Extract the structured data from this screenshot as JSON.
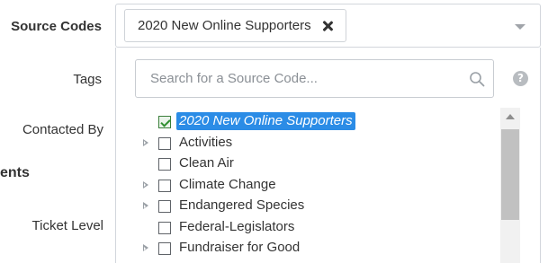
{
  "form": {
    "source_codes_label": "Source Codes",
    "tags_label": "Tags",
    "contacted_by_label": "Contacted By",
    "section_partial_label": "ents",
    "ticket_level_label": "Ticket Level"
  },
  "source_select": {
    "selected_chip": "2020 New Online Supporters",
    "remove_icon": "close-icon",
    "caret_icon": "chevron-down-icon"
  },
  "dropdown": {
    "search_placeholder": "Search for a Source Code...",
    "search_value": "",
    "search_icon": "search-icon",
    "help_icon": "question-circle-icon",
    "help_glyph": "?",
    "items": [
      {
        "label": "2020 New Online Supporters",
        "checked": true,
        "selected": true,
        "expandable": false
      },
      {
        "label": "Activities",
        "checked": false,
        "selected": false,
        "expandable": true
      },
      {
        "label": "Clean Air",
        "checked": false,
        "selected": false,
        "expandable": false
      },
      {
        "label": "Climate Change",
        "checked": false,
        "selected": false,
        "expandable": true
      },
      {
        "label": "Endangered Species",
        "checked": false,
        "selected": false,
        "expandable": true
      },
      {
        "label": "Federal-Legislators",
        "checked": false,
        "selected": false,
        "expandable": false
      },
      {
        "label": "Fundraiser for Good",
        "checked": false,
        "selected": false,
        "expandable": true
      }
    ]
  },
  "colors": {
    "selected_highlight": "#2b8ce6",
    "check_green": "#2f8f2f",
    "scroll_thumb": "#c1c1c1"
  }
}
